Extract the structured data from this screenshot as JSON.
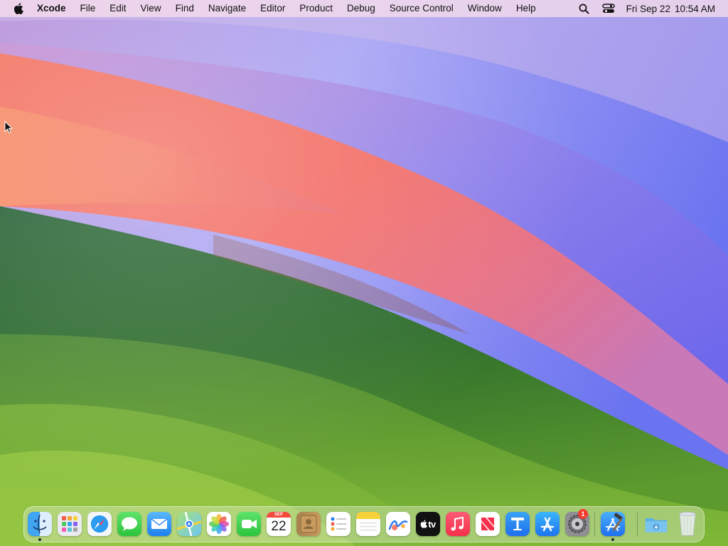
{
  "menubar": {
    "app_name": "Xcode",
    "menus": [
      "File",
      "Edit",
      "View",
      "Find",
      "Navigate",
      "Editor",
      "Product",
      "Debug",
      "Source Control",
      "Window",
      "Help"
    ],
    "clock_date": "Fri Sep 22",
    "clock_time": "10:54 AM",
    "icons": {
      "apple": "apple-logo-icon",
      "search": "spotlight-search-icon",
      "control": "control-center-icon"
    }
  },
  "dock": {
    "calendar_month": "SEP",
    "calendar_day": "22",
    "tv_label": "tv",
    "settings_badge": "1",
    "apps": [
      "Finder",
      "Launchpad",
      "Safari",
      "Messages",
      "Mail",
      "Maps",
      "Photos",
      "FaceTime",
      "Calendar",
      "Contacts",
      "Reminders",
      "Notes",
      "Freeform",
      "TV",
      "Music",
      "News",
      "Keynote",
      "App Store",
      "System Settings",
      "Xcode",
      "Downloads",
      "Trash"
    ]
  },
  "colors": {
    "menubar_bg": "#f6deec",
    "badge": "#f43b30",
    "wallpaper_green": "#1e5a2e",
    "wallpaper_red": "#f26a5c",
    "wallpaper_blue": "#6f7cf0"
  }
}
